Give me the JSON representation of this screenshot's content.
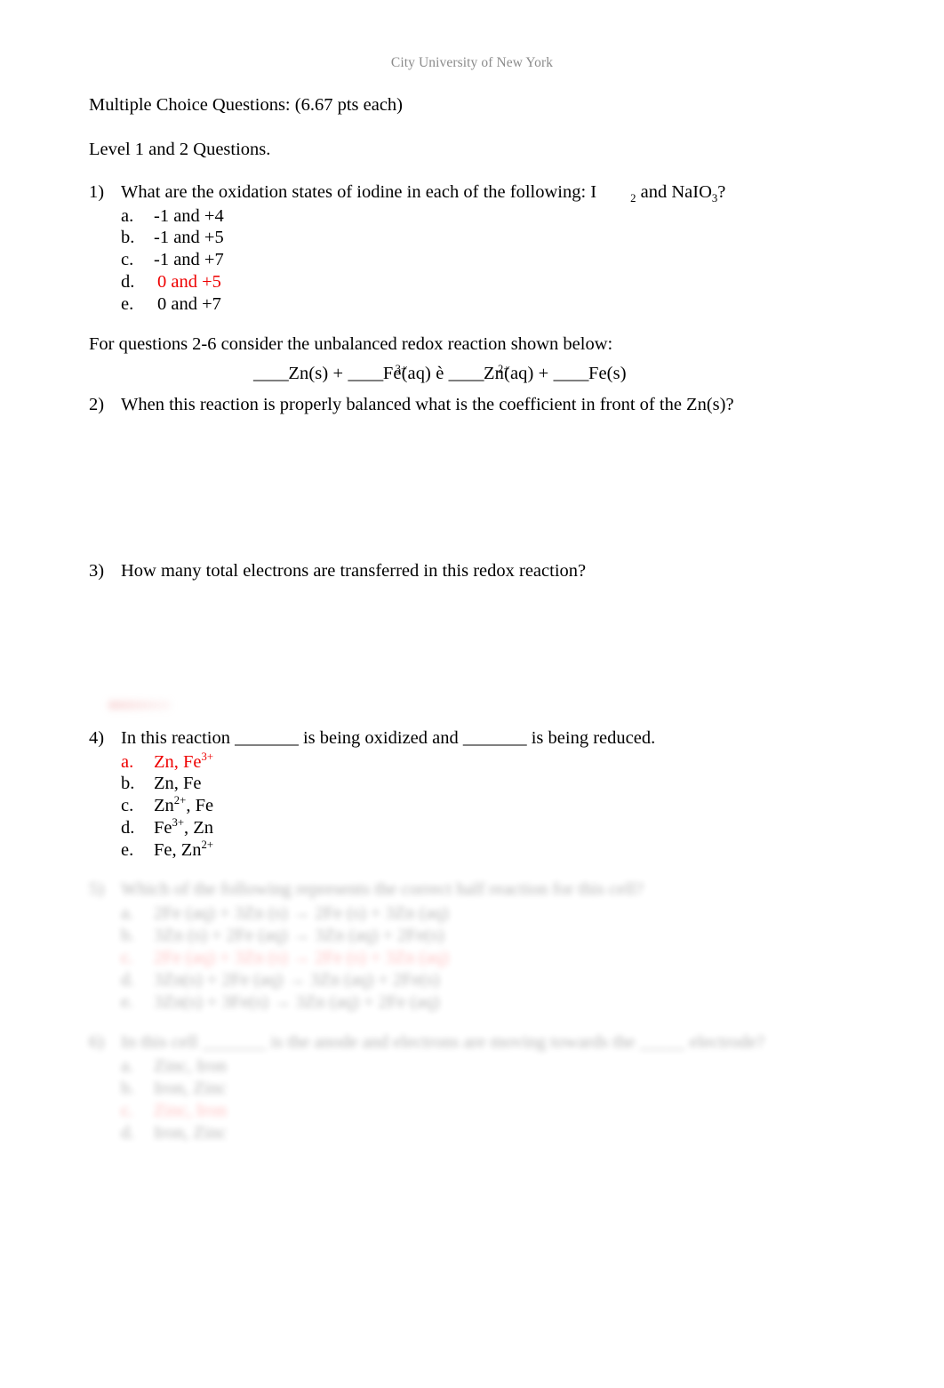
{
  "header": {
    "institution": "City University of New York"
  },
  "intro": {
    "section_title": "Multiple Choice Questions: (6.67 pts each)",
    "level_note": "Level 1 and 2 Questions."
  },
  "questions": [
    {
      "number": "1)",
      "stem_before_formula": "What are the oxidation states of iodine in each of the following: I",
      "formula_subscript": "2",
      "stem_after_formula": "and NaIO",
      "formula_subscript2": "3",
      "stem_tail": "?",
      "options": [
        {
          "letter": "a.",
          "text": "-1 and +4",
          "answer": false
        },
        {
          "letter": "b.",
          "text": "-1 and +5",
          "answer": false
        },
        {
          "letter": "c.",
          "text": "-1 and +7",
          "answer": false
        },
        {
          "letter": "d.",
          "text": "0 and +5",
          "answer": true
        },
        {
          "letter": "e.",
          "text": "0 and +7",
          "answer": false
        }
      ]
    }
  ],
  "reaction_intro": "For questions 2-6   consider the unbalanced redox reaction shown below:",
  "equation": {
    "blank1": "____",
    "species1": "Zn(s)",
    "plus1": "+",
    "blank2": "____",
    "species2": "Fe",
    "charge2": "3+",
    "state2": "(aq)",
    "arrow": "è",
    "blank3": "____",
    "species3": "Zn",
    "charge3": "2+",
    "state3": "(aq)",
    "plus2": "+",
    "blank4": "____",
    "species4": "Fe(s)"
  },
  "question2": {
    "number": "2)",
    "stem": "When this reaction is properly balanced what is the coefficient in front of the Zn(s)?"
  },
  "question3": {
    "number": "3)",
    "stem": "How many total electrons are transferred in this redox reaction?"
  },
  "question4": {
    "number": "4)",
    "stem_part1": "In this reaction _______ is being oxidized and _______ is being reduced.",
    "options": [
      {
        "letter": "a.",
        "base": "Zn, Fe",
        "sup": "3+",
        "answer": true
      },
      {
        "letter": "b.",
        "base": "Zn, Fe",
        "sup": "",
        "answer": false
      },
      {
        "letter": "c.",
        "base": "Zn",
        "sup": "2+",
        "tail": ", Fe",
        "answer": false
      },
      {
        "letter": "d.",
        "base": "Fe",
        "sup": "3+",
        "tail": ", Zn",
        "answer": false
      },
      {
        "letter": "e.",
        "base": "Fe, Zn",
        "sup": "2+",
        "answer": false
      }
    ]
  },
  "question5_redacted": {
    "number": "5)",
    "stem": "Which of the following represents the correct half reaction for this cell?",
    "options": [
      {
        "letter": "a.",
        "text": "2Fe (aq)  +  3Zn (s)  →  2Fe (s)  +  3Zn (aq)",
        "answer": false
      },
      {
        "letter": "b.",
        "text": "3Zn (s)  +  2Fe (aq)  →  3Zn (aq)  +  2Fe(s)",
        "answer": false
      },
      {
        "letter": "c.",
        "text": "2Fe (aq)  +  3Zn (s)  →  2Fe (s)  +  3Zn (aq)",
        "answer": true
      },
      {
        "letter": "d.",
        "text": "3Zn(s)  +  2Fe (aq)  →  3Zn (aq)  +  2Fe(s)",
        "answer": false
      },
      {
        "letter": "e.",
        "text": "3Zn(s)  +  3Fe(s)  →  3Zn (aq)  +  2Fe (aq)",
        "answer": false
      }
    ]
  },
  "question6_redacted": {
    "number": "6)",
    "stem": "In this cell _______ is the anode and electrons are moving towards the _____ electrode?",
    "options": [
      {
        "letter": "a.",
        "text": "Zinc, Iron",
        "answer": false
      },
      {
        "letter": "b.",
        "text": "Iron, Zinc",
        "answer": false
      },
      {
        "letter": "c.",
        "text": "Zinc, Iron",
        "answer": true
      },
      {
        "letter": "d.",
        "text": "Iron, Zinc",
        "answer": false
      }
    ]
  },
  "colors": {
    "answer_red": "#ee0000",
    "header_gray": "#8b8b8b",
    "body_black": "#000000"
  }
}
